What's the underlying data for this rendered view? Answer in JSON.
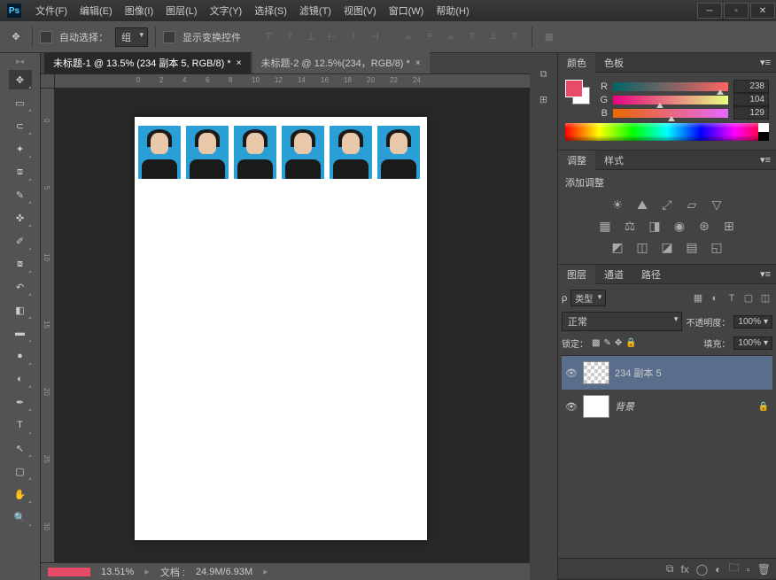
{
  "menus": [
    "文件(F)",
    "编辑(E)",
    "图像(I)",
    "图层(L)",
    "文字(Y)",
    "选择(S)",
    "滤镜(T)",
    "视图(V)",
    "窗口(W)",
    "帮助(H)"
  ],
  "options": {
    "auto_select": "自动选择：",
    "group": "组",
    "show_transform": "显示变换控件"
  },
  "tabs": [
    {
      "title": "未标题-1 @ 13.5% (234 副本 5, RGB/8) *",
      "active": true
    },
    {
      "title": "未标题-2 @ 12.5%(234，RGB/8) *",
      "active": false
    }
  ],
  "ruler_h": [
    "0",
    "2",
    "4",
    "6",
    "8",
    "10",
    "12",
    "14",
    "16",
    "18",
    "20",
    "22",
    "24"
  ],
  "ruler_v": [
    "0",
    "5",
    "10",
    "15",
    "20",
    "25",
    "30"
  ],
  "status": {
    "zoom": "13.51%",
    "doc_label": "文档 :",
    "doc_size": "24.9M/6.93M"
  },
  "color_panel": {
    "tab1": "颜色",
    "tab2": "色板",
    "r_label": "R",
    "r_value": "238",
    "g_label": "G",
    "g_value": "104",
    "b_label": "B",
    "b_value": "129",
    "fg_color": "#e84a6a"
  },
  "adjust_panel": {
    "tab1": "调整",
    "tab2": "样式",
    "label": "添加调整"
  },
  "layers_panel": {
    "tab1": "图层",
    "tab2": "通道",
    "tab3": "路径",
    "filter_label": "类型",
    "blend_mode": "正常",
    "opacity_label": "不透明度：",
    "opacity_value": "100%",
    "lock_label": "锁定：",
    "fill_label": "填充：",
    "fill_value": "100%",
    "layers": [
      {
        "name": "234 副本 5",
        "selected": true,
        "checker": true,
        "locked": false
      },
      {
        "name": "背景",
        "selected": false,
        "checker": false,
        "locked": true
      }
    ]
  }
}
